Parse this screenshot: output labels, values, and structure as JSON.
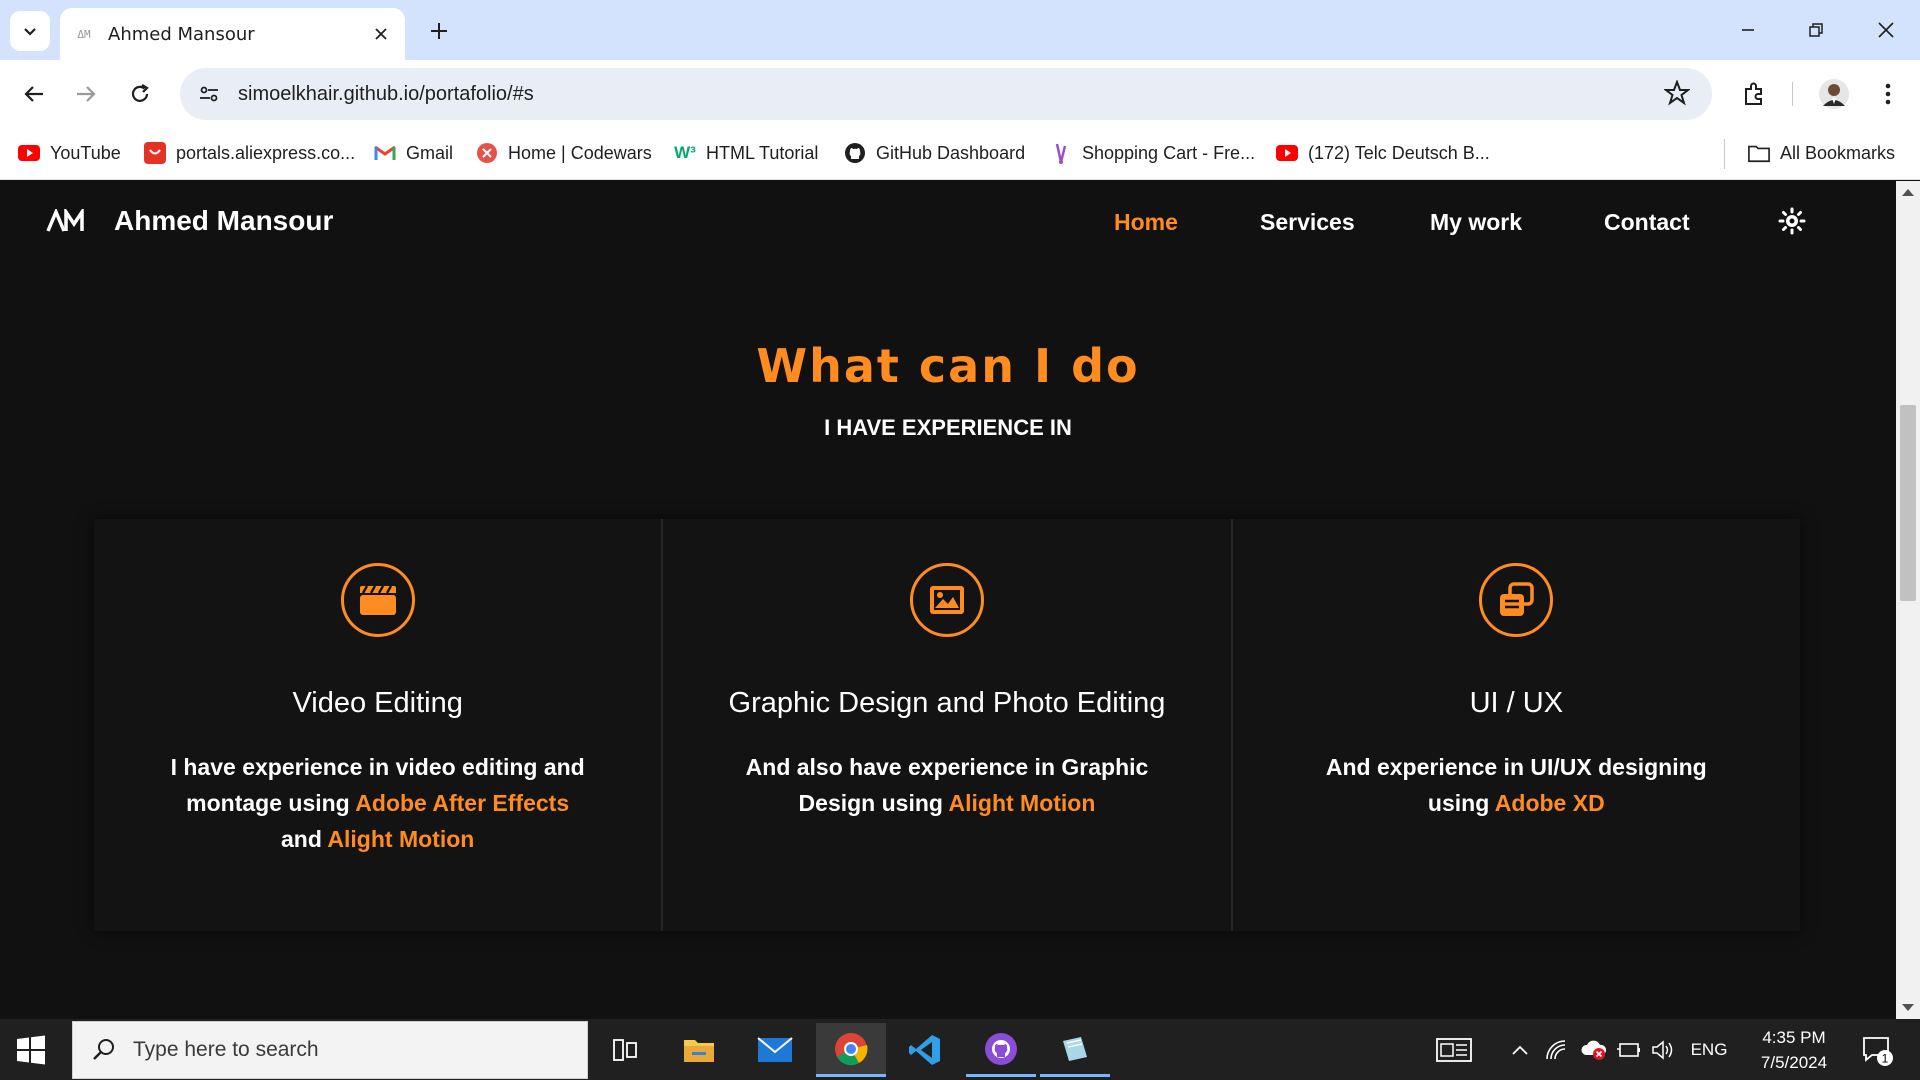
{
  "browser": {
    "tab_title": "Ahmed Mansour",
    "url": "simoelkhair.github.io/portafolio/#s",
    "bookmarks": [
      {
        "label": "YouTube",
        "icon": "youtube-icon"
      },
      {
        "label": "portals.aliexpress.co...",
        "icon": "aliexpress-icon"
      },
      {
        "label": "Gmail",
        "icon": "gmail-icon"
      },
      {
        "label": "Home | Codewars",
        "icon": "codewars-icon"
      },
      {
        "label": "HTML Tutorial",
        "icon": "w3schools-icon"
      },
      {
        "label": "GitHub Dashboard",
        "icon": "github-icon"
      },
      {
        "label": "Shopping Cart - Fre...",
        "icon": "shopping-cart-icon"
      },
      {
        "label": "(172) Telc Deutsch B...",
        "icon": "youtube-icon"
      }
    ],
    "all_bookmarks": "All Bookmarks"
  },
  "site": {
    "name": "Ahmed Mansour",
    "logo_text": "AM",
    "nav": [
      "Home",
      "Services",
      "My work",
      "Contact"
    ],
    "active_nav": "Home",
    "accent_color": "#ff8c21"
  },
  "services": {
    "title": "What can I do",
    "subtitle": "I HAVE EXPERIENCE IN",
    "cards": [
      {
        "icon": "clapperboard-icon",
        "title": "Video Editing",
        "text_before": "I have experience in video editing and montage using ",
        "highlight1": "Adobe After Effects",
        "text_mid": " and ",
        "highlight2": "Alight Motion"
      },
      {
        "icon": "image-icon",
        "title": "Graphic Design and Photo Editing",
        "text_before": "And also have experience in Graphic Design using ",
        "highlight1": "Alight Motion"
      },
      {
        "icon": "layers-icon",
        "title": "UI / UX",
        "text_before": "And experience in UI/UX designing using ",
        "highlight1": "Adobe XD"
      }
    ]
  },
  "taskbar": {
    "search_placeholder": "Type here to search",
    "language": "ENG",
    "time": "4:35 PM",
    "date": "7/5/2024",
    "notification_count": "1"
  }
}
